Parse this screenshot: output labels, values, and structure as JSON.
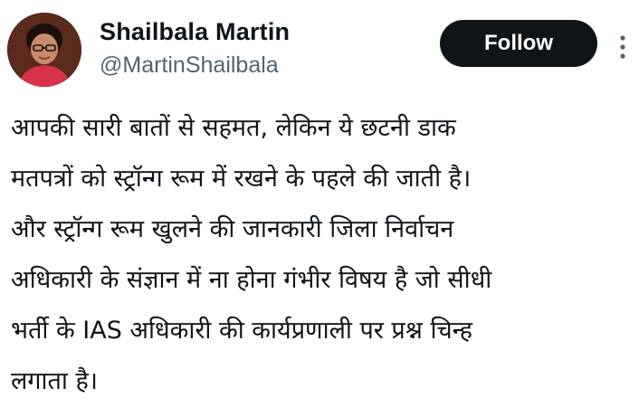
{
  "author": {
    "display_name": "Shailbala Martin",
    "handle": "@MartinShailbala",
    "avatar_icon": "avatar-photo"
  },
  "actions": {
    "follow_label": "Follow",
    "more_icon": "more-vertical-icon"
  },
  "tweet": {
    "lines": [
      "आपकी सारी बातों से सहमत, लेकिन ये छटनी डाक",
      "मतपत्रों को स्ट्रॉन्ग रूम में रखने के पहले की जाती है।",
      "और स्ट्रॉन्ग रूम खुलने की जानकारी जिला निर्वाचन",
      "अधिकारी के संज्ञान में ना होना गंभीर विषय है जो सीधी",
      "भर्ती के IAS अधिकारी की कार्यप्रणाली पर प्रश्न चिन्ह",
      "लगाता है।"
    ]
  },
  "colors": {
    "text": "#0f1419",
    "secondary": "#536471",
    "button_bg": "#0f1419",
    "button_text": "#ffffff"
  }
}
